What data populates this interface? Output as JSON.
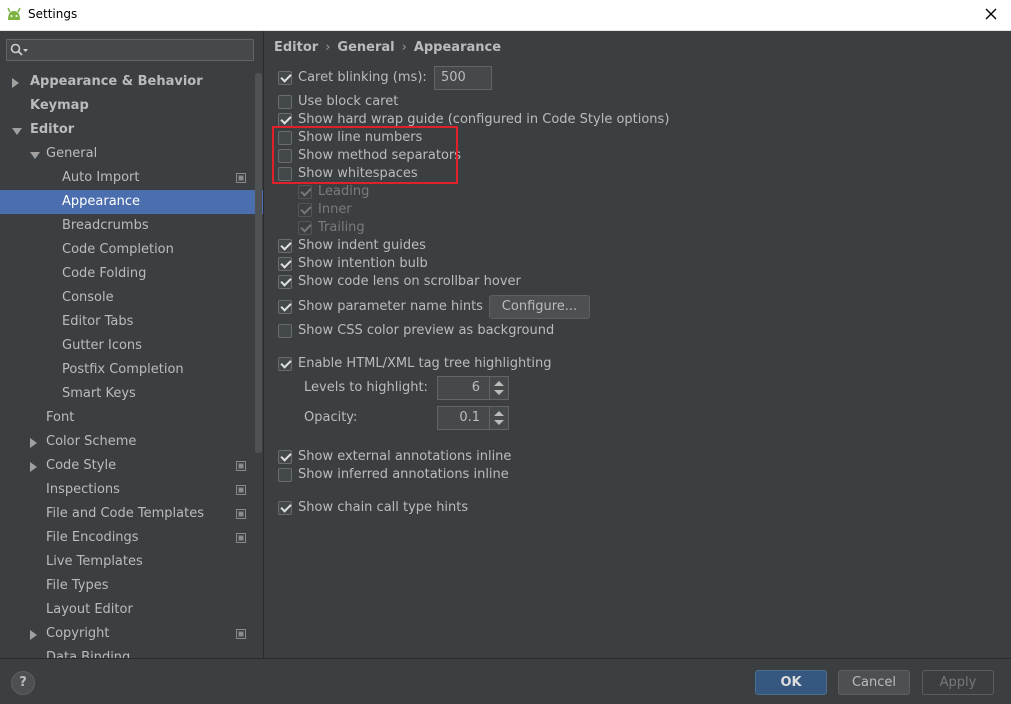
{
  "window": {
    "title": "Settings"
  },
  "search": {
    "placeholder": ""
  },
  "sidebar": {
    "items": [
      {
        "label": "Appearance & Behavior",
        "level": 0,
        "arrow": "right",
        "bold": true
      },
      {
        "label": "Keymap",
        "level": 0,
        "arrow": "",
        "bold": true
      },
      {
        "label": "Editor",
        "level": 0,
        "arrow": "down",
        "bold": true
      },
      {
        "label": "General",
        "level": 1,
        "arrow": "down"
      },
      {
        "label": "Auto Import",
        "level": 2,
        "project_icon": true
      },
      {
        "label": "Appearance",
        "level": 2,
        "selected": true
      },
      {
        "label": "Breadcrumbs",
        "level": 2
      },
      {
        "label": "Code Completion",
        "level": 2
      },
      {
        "label": "Code Folding",
        "level": 2
      },
      {
        "label": "Console",
        "level": 2
      },
      {
        "label": "Editor Tabs",
        "level": 2
      },
      {
        "label": "Gutter Icons",
        "level": 2
      },
      {
        "label": "Postfix Completion",
        "level": 2
      },
      {
        "label": "Smart Keys",
        "level": 2
      },
      {
        "label": "Font",
        "level": 1
      },
      {
        "label": "Color Scheme",
        "level": 1,
        "arrow": "right"
      },
      {
        "label": "Code Style",
        "level": 1,
        "arrow": "right",
        "project_icon": true
      },
      {
        "label": "Inspections",
        "level": 1,
        "project_icon": true
      },
      {
        "label": "File and Code Templates",
        "level": 1,
        "project_icon": true
      },
      {
        "label": "File Encodings",
        "level": 1,
        "project_icon": true
      },
      {
        "label": "Live Templates",
        "level": 1
      },
      {
        "label": "File Types",
        "level": 1
      },
      {
        "label": "Layout Editor",
        "level": 1
      },
      {
        "label": "Copyright",
        "level": 1,
        "arrow": "right",
        "project_icon": true
      },
      {
        "label": "Data Binding",
        "level": 1
      }
    ]
  },
  "breadcrumb": {
    "items": [
      "Editor",
      "General",
      "Appearance"
    ]
  },
  "settings": {
    "caret_blinking": {
      "label": "Caret blinking (ms):",
      "checked": true,
      "value": "500"
    },
    "use_block_caret": {
      "label": "Use block caret",
      "checked": false
    },
    "hard_wrap": {
      "label": "Show hard wrap guide (configured in Code Style options)",
      "checked": true
    },
    "line_numbers": {
      "label": "Show line numbers",
      "checked": false
    },
    "method_separators": {
      "label": "Show method separators",
      "checked": false
    },
    "whitespaces": {
      "label": "Show whitespaces",
      "checked": false
    },
    "leading": {
      "label": "Leading",
      "checked": true
    },
    "inner": {
      "label": "Inner",
      "checked": true
    },
    "trailing": {
      "label": "Trailing",
      "checked": true
    },
    "indent_guides": {
      "label": "Show indent guides",
      "checked": true
    },
    "intention_bulb": {
      "label": "Show intention bulb",
      "checked": true
    },
    "code_lens": {
      "label": "Show code lens on scrollbar hover",
      "checked": true
    },
    "param_hints": {
      "label": "Show parameter name hints",
      "checked": true,
      "button": "Configure..."
    },
    "css_preview": {
      "label": "Show CSS color preview as background",
      "checked": false
    },
    "tag_tree": {
      "label": "Enable HTML/XML tag tree highlighting",
      "checked": true
    },
    "levels": {
      "label": "Levels to highlight:",
      "value": "6"
    },
    "opacity": {
      "label": "Opacity:",
      "value": "0.1"
    },
    "external_annotations": {
      "label": "Show external annotations inline",
      "checked": true
    },
    "inferred_annotations": {
      "label": "Show inferred annotations inline",
      "checked": false
    },
    "chain_call": {
      "label": "Show chain call type hints",
      "checked": true
    }
  },
  "footer": {
    "help": "?",
    "ok": "OK",
    "cancel": "Cancel",
    "apply": "Apply"
  },
  "colors": {
    "background": "#3c3f41",
    "selection": "#4b6eaf",
    "highlight_box": "#e0202a",
    "ok_button": "#365880"
  }
}
